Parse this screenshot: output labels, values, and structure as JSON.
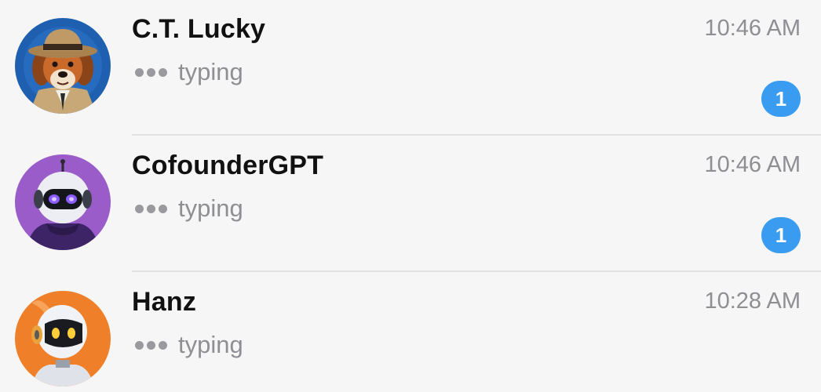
{
  "chats": [
    {
      "name": "C.T. Lucky",
      "time": "10:46 AM",
      "status": "typing",
      "unread": "1",
      "avatar_icon": "detective-dog-avatar",
      "avatar_bg": "#1f5fb0"
    },
    {
      "name": "CofounderGPT",
      "time": "10:46 AM",
      "status": "typing",
      "unread": "1",
      "avatar_icon": "robot-purple-avatar",
      "avatar_bg": "#9a5cc9"
    },
    {
      "name": "Hanz",
      "time": "10:28 AM",
      "status": "typing",
      "avatar_icon": "robot-orange-avatar",
      "avatar_bg": "#f07f2a"
    }
  ],
  "colors": {
    "background": "#f6f6f6",
    "badge": "#3a9cf0",
    "secondary_text": "#8e8e93",
    "separator": "#e2e2e4"
  }
}
